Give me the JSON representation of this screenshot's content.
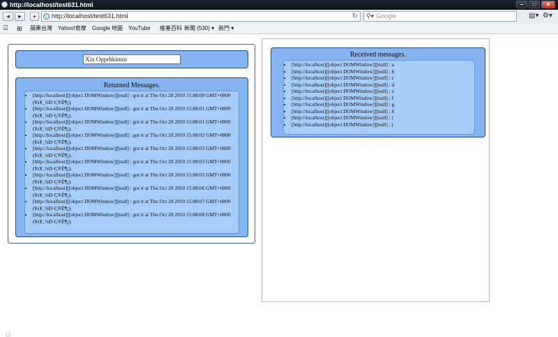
{
  "window": {
    "title": "http://localhost/test631.html"
  },
  "navigation": {
    "back": "◄",
    "forward": "►",
    "new_tab": "+",
    "url": "http://localhost/test631.html",
    "reload": "↻",
    "search_placeholder": "Google"
  },
  "bookmarks": [
    "蘋果台灣",
    "Yahoo!奇摩",
    "Google 地圖",
    "YouTube",
    "維基百科",
    "新聞 (530) ▾",
    "熱門 ▾"
  ],
  "sender": {
    "input_value": "Xin Opprhkimnr",
    "returned_title": "Returned Messages.",
    "messages": [
      "[http://localhost][[object DOMWindow]][null] : got it at Thu Oct 28 2010 15:08:00 GMT+0800 (¥x¥_¼Ð·Ç®É¶¡).",
      "[http://localhost][[object DOMWindow]][null] : got it at Thu Oct 28 2010 15:08:01 GMT+0800 (¥x¥_¼Ð·Ç®É¶¡).",
      "[http://localhost][[object DOMWindow]][null] : got it at Thu Oct 28 2010 15:08:01 GMT+0800 (¥x¥_¼Ð·Ç®É¶¡).",
      "[http://localhost][[object DOMWindow]][null] : got it at Thu Oct 28 2010 15:08:02 GMT+0800 (¥x¥_¼Ð·Ç®É¶¡).",
      "[http://localhost][[object DOMWindow]][null] : got it at Thu Oct 28 2010 15:08:03 GMT+0800 (¥x¥_¼Ð·Ç®É¶¡).",
      "[http://localhost][[object DOMWindow]][null] : got it at Thu Oct 28 2010 15:08:03 GMT+0800 (¥x¥_¼Ð·Ç®É¶¡).",
      "[http://localhost][[object DOMWindow]][null] : got it at Thu Oct 28 2010 15:08:05 GMT+0800 (¥x¥_¼Ð·Ç®É¶¡).",
      "[http://localhost][[object DOMWindow]][null] : got it at Thu Oct 28 2010 15:08:06 GMT+0800 (¥x¥_¼Ð·Ç®É¶¡).",
      "[http://localhost][[object DOMWindow]][null] : got it at Thu Oct 28 2010 15:08:07 GMT+0800 (¥x¥_¼Ð·Ç®É¶¡).",
      "[http://localhost][[object DOMWindow]][null] : got it at Thu Oct 28 2010 15:08:08 GMT+0800 (¥x¥_¼Ð·Ç®É¶¡)."
    ]
  },
  "receiver": {
    "title": "Received messages.",
    "messages": [
      "[http://localhost][[object DOMWindow]][null] : a",
      "[http://localhost][[object DOMWindow]][null] : b",
      "[http://localhost][[object DOMWindow]][null] : c",
      "[http://localhost][[object DOMWindow]][null] : d",
      "[http://localhost][[object DOMWindow]][null] : e",
      "[http://localhost][[object DOMWindow]][null] : f",
      "[http://localhost][[object DOMWindow]][null] : g",
      "[http://localhost][[object DOMWindow]][null] : h",
      "[http://localhost][[object DOMWindow]][null] : i",
      "[http://localhost][[object DOMWindow]][null] : j"
    ]
  },
  "colors": {
    "panel": "#86b3f2",
    "panel_inner": "#a6ccfa",
    "panel_border": "#1f4f80"
  }
}
